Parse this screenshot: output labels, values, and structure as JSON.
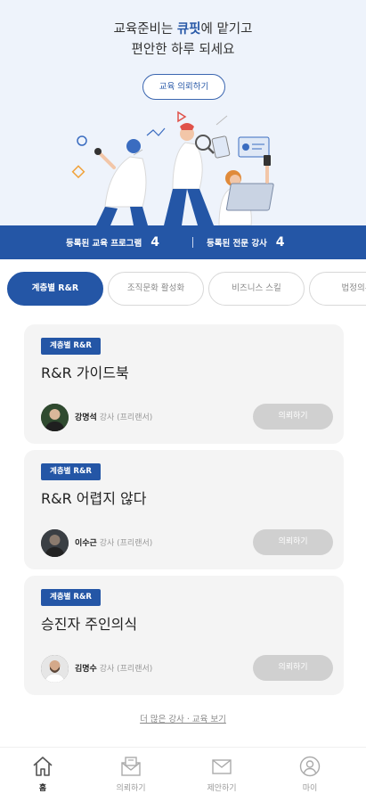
{
  "hero": {
    "line1_prefix": "교육준비는 ",
    "line1_accent": "큐핏",
    "line1_suffix": "에 맡기고",
    "line2": "편안한 하루 되세요",
    "request_button": "교육 의뢰하기",
    "accent_color": "#2a5aa8"
  },
  "stats": {
    "programs_label": "등록된 교육 프로그램",
    "programs_count": "4",
    "instructors_label": "등록된 전문 강사",
    "instructors_count": "4",
    "bar_color": "#2456a6"
  },
  "tabs": [
    {
      "label": "계층별 R&R",
      "active": true
    },
    {
      "label": "조직문화 활성화",
      "active": false
    },
    {
      "label": "비즈니스 스킬",
      "active": false
    },
    {
      "label": "법정의무",
      "active": false
    }
  ],
  "courses": [
    {
      "badge": "계층별 R&R",
      "title": "R&R 가이드북",
      "instructor_name": "강명석",
      "instructor_suffix": " 강사 (프리랜서)",
      "button": "의뢰하기"
    },
    {
      "badge": "계층별 R&R",
      "title": "R&R 어렵지 않다",
      "instructor_name": "이수근",
      "instructor_suffix": " 강사 (프리랜서)",
      "button": "의뢰하기"
    },
    {
      "badge": "계층별 R&R",
      "title": "승진자 주인의식",
      "instructor_name": "김명수",
      "instructor_suffix": " 강사 (프리랜서)",
      "button": "의뢰하기"
    }
  ],
  "more_link": "더 많은 강사 · 교육 보기",
  "bottom_nav": [
    {
      "label": "홈",
      "icon": "home-icon",
      "active": true
    },
    {
      "label": "의뢰하기",
      "icon": "request-envelope-icon",
      "active": false
    },
    {
      "label": "제안하기",
      "icon": "mail-icon",
      "active": false
    },
    {
      "label": "마이",
      "icon": "user-icon",
      "active": false
    }
  ]
}
